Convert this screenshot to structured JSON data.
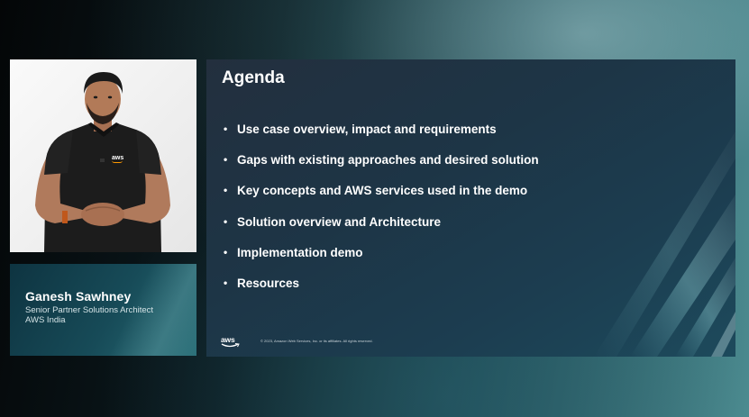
{
  "presenter": {
    "name": "Ganesh Sawhney",
    "role": "Senior Partner Solutions Architect",
    "org": "AWS India",
    "shirt_logo": "aws"
  },
  "slide": {
    "title": "Agenda",
    "items": [
      "Use case overview, impact and requirements",
      "Gaps with existing approaches and desired solution",
      "Key concepts and AWS services used in the demo",
      "Solution overview and Architecture",
      "Implementation demo",
      "Resources"
    ],
    "bullet": "•",
    "logo": "aws",
    "copyright": "© 2023, Amazon Web Services, Inc. or its affiliates. All rights reserved."
  },
  "colors": {
    "slide_bg": "#232f3e",
    "accent": "#ff9900",
    "text": "#ffffff"
  }
}
